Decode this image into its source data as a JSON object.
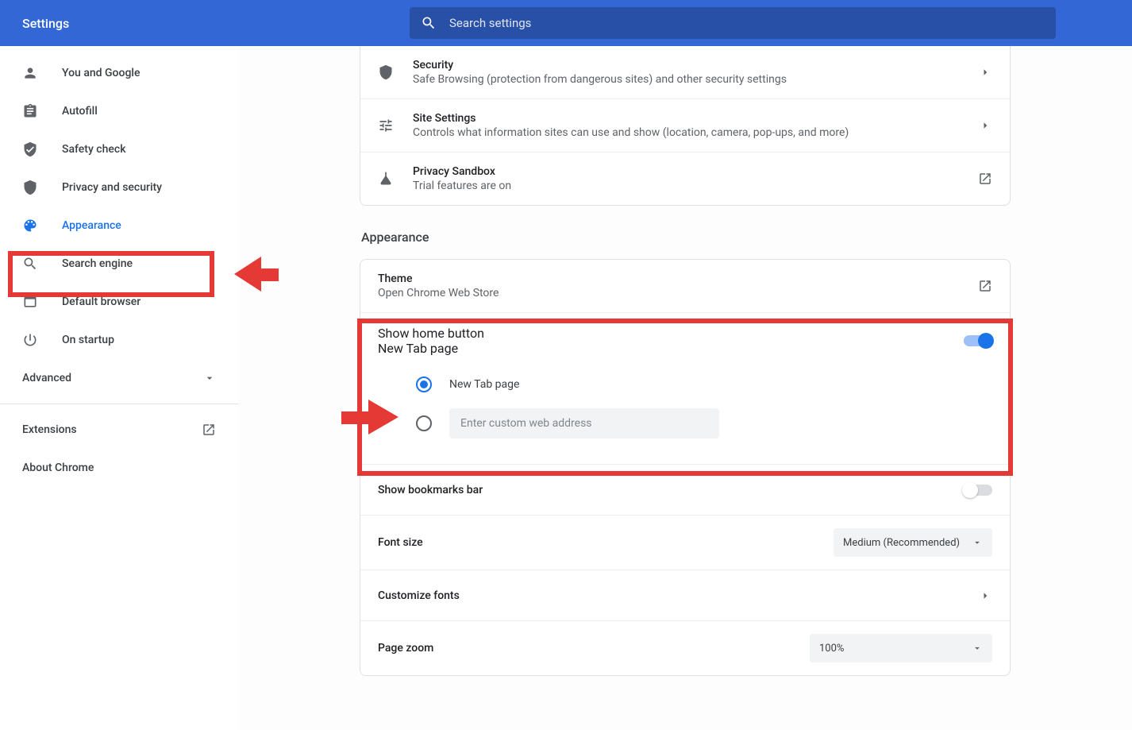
{
  "header": {
    "title": "Settings",
    "search_placeholder": "Search settings"
  },
  "sidebar": {
    "items": [
      {
        "label": "You and Google"
      },
      {
        "label": "Autofill"
      },
      {
        "label": "Safety check"
      },
      {
        "label": "Privacy and security"
      },
      {
        "label": "Appearance"
      },
      {
        "label": "Search engine"
      },
      {
        "label": "Default browser"
      },
      {
        "label": "On startup"
      }
    ],
    "advanced": "Advanced",
    "extensions": "Extensions",
    "about": "About Chrome"
  },
  "security_card": {
    "security": {
      "title": "Security",
      "sub": "Safe Browsing (protection from dangerous sites) and other security settings"
    },
    "site": {
      "title": "Site Settings",
      "sub": "Controls what information sites can use and show (location, camera, pop-ups, and more)"
    },
    "sandbox": {
      "title": "Privacy Sandbox",
      "sub": "Trial features are on"
    }
  },
  "appearance": {
    "section": "Appearance",
    "theme": {
      "title": "Theme",
      "sub": "Open Chrome Web Store"
    },
    "home": {
      "title": "Show home button",
      "sub": "New Tab page",
      "radio_newtab": "New Tab page",
      "custom_placeholder": "Enter custom web address"
    },
    "bookmarks": "Show bookmarks bar",
    "fontsize": {
      "label": "Font size",
      "value": "Medium (Recommended)"
    },
    "customize": "Customize fonts",
    "zoom": {
      "label": "Page zoom",
      "value": "100%"
    }
  }
}
